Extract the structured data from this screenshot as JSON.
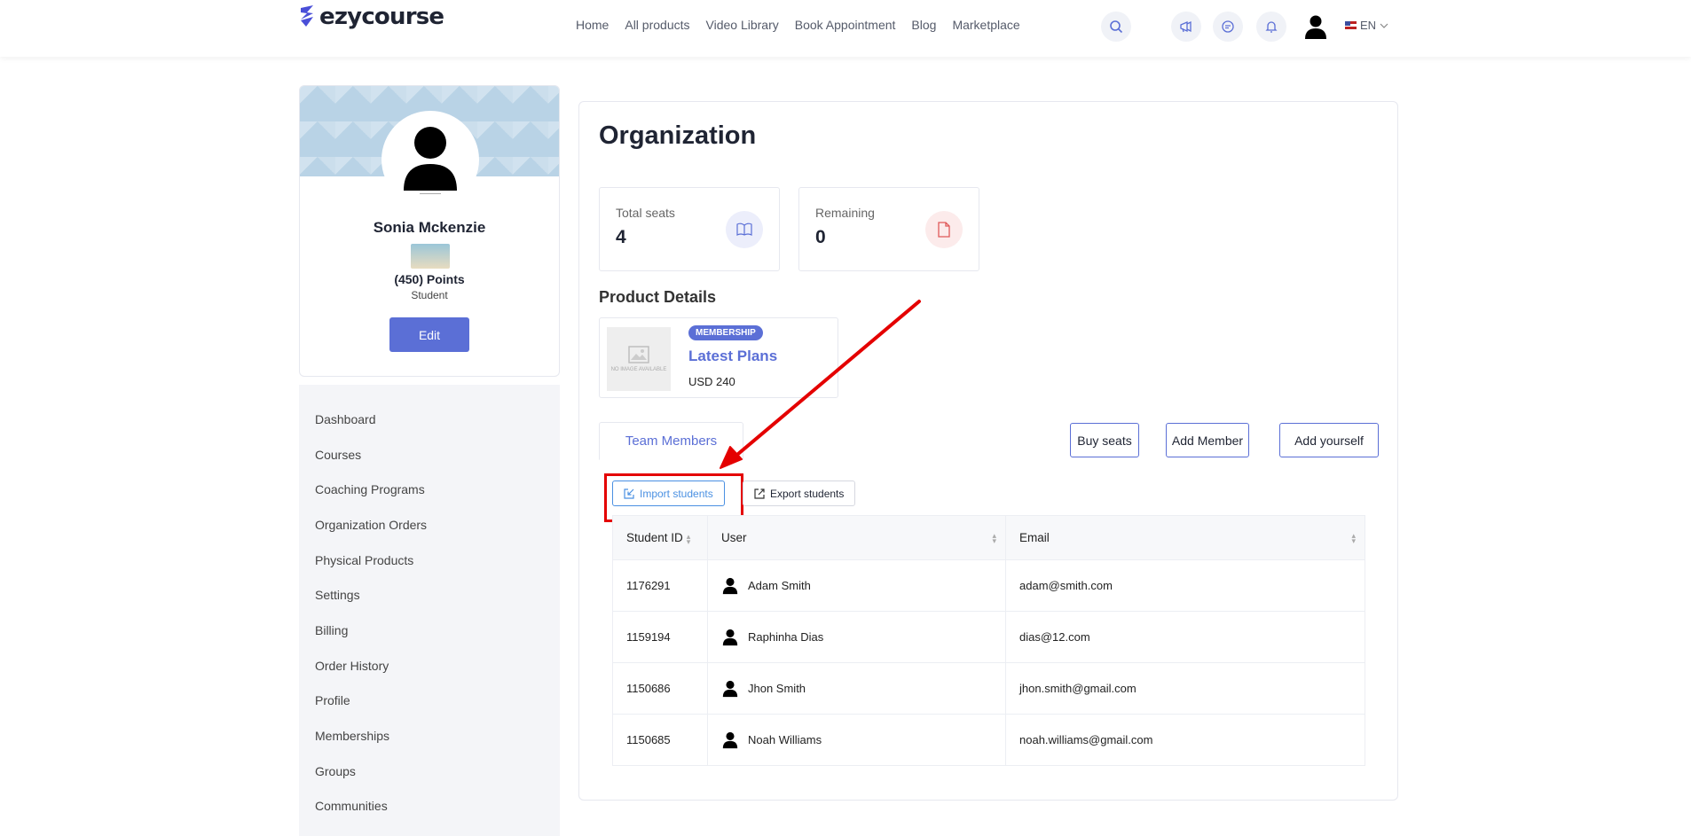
{
  "header": {
    "logo_text": "ezycourse",
    "nav": [
      "Home",
      "All products",
      "Video Library",
      "Book Appointment",
      "Blog",
      "Marketplace"
    ],
    "icons": [
      "search-icon",
      "megaphone-icon",
      "chat-icon",
      "bell-icon"
    ],
    "language": "EN"
  },
  "profile": {
    "name": "Sonia Mckenzie",
    "points": "(450) Points",
    "role": "Student",
    "edit_label": "Edit"
  },
  "sidebar": {
    "items": [
      "Dashboard",
      "Courses",
      "Coaching Programs",
      "Organization Orders",
      "Physical Products",
      "Settings",
      "Billing",
      "Order History",
      "Profile",
      "Memberships",
      "Groups",
      "Communities"
    ]
  },
  "main": {
    "title": "Organization",
    "stats": [
      {
        "label": "Total seats",
        "value": "4",
        "icon": "book-icon",
        "color": "#5b6fd6"
      },
      {
        "label": "Remaining",
        "value": "0",
        "icon": "file-icon",
        "color": "#e05a5a"
      }
    ],
    "product_section_title": "Product Details",
    "product": {
      "tag": "MEMBERSHIP",
      "name": "Latest Plans",
      "price": "USD 240",
      "image_placeholder": "NO IMAGE AVAILABLE"
    },
    "tab": "Team Members",
    "actions": {
      "buy_seats": "Buy seats",
      "add_member": "Add Member",
      "add_yourself": "Add yourself"
    },
    "import_label": "Import students",
    "export_label": "Export students",
    "table": {
      "headers": [
        "Student ID",
        "User",
        "Email"
      ],
      "rows": [
        {
          "id": "1176291",
          "user": "Adam Smith",
          "email": "adam@smith.com"
        },
        {
          "id": "1159194",
          "user": "Raphinha Dias",
          "email": "dias@12.com"
        },
        {
          "id": "1150686",
          "user": "Jhon Smith",
          "email": "jhon.smith@gmail.com"
        },
        {
          "id": "1150685",
          "user": "Noah Williams",
          "email": "noah.williams@gmail.com"
        }
      ]
    }
  },
  "annotation": {
    "color": "#e40000"
  }
}
